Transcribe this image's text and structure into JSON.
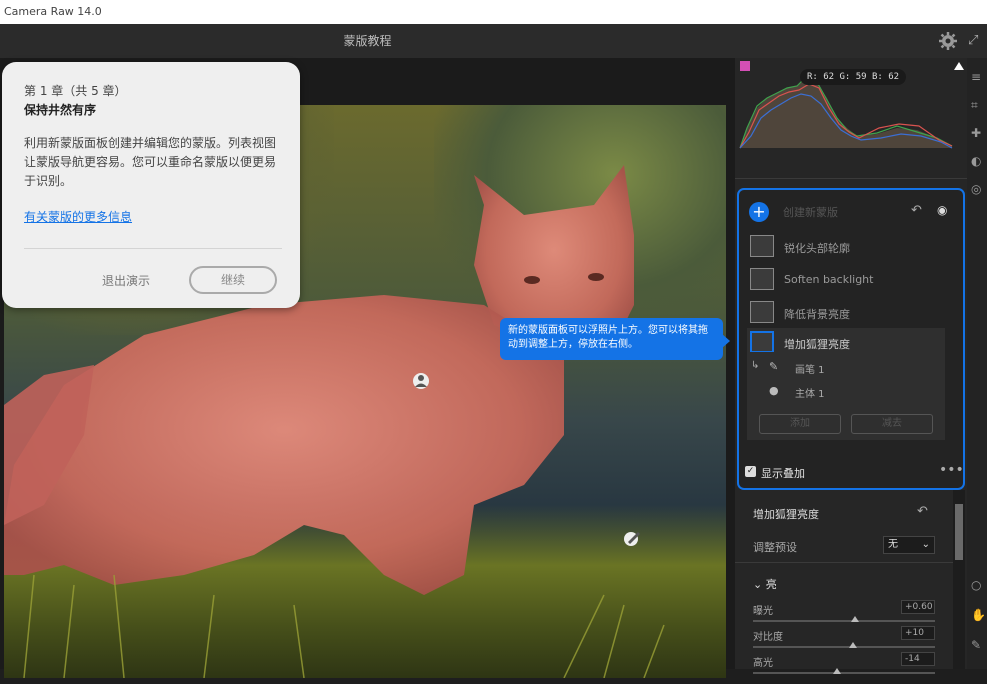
{
  "app": {
    "title": "Camera Raw 14.0"
  },
  "document": {
    "title": "蒙版教程"
  },
  "histogram": {
    "readout": "R: 62   G: 59   B: 62"
  },
  "tour": {
    "chapter": "第 1 章（共 5 章）",
    "heading": "保持井然有序",
    "body": "利用新蒙版面板创建并编辑您的蒙版。列表视图让蒙版导航更容易。您可以重命名蒙版以便更易于识别。",
    "link": "有关蒙版的更多信息",
    "exit_label": "退出演示",
    "continue_label": "继续"
  },
  "callout": {
    "text": "新的蒙版面板可以浮照片上方。您可以将其拖动到调整上方，停放在右侧。"
  },
  "mask_panel": {
    "create_label": "创建新蒙版",
    "masks": [
      {
        "label": "锐化头部轮廓"
      },
      {
        "label": "Soften backlight"
      },
      {
        "label": "降低背景亮度"
      },
      {
        "label": "增加狐狸亮度"
      }
    ],
    "components": [
      {
        "label": "画笔 1"
      },
      {
        "label": "主体 1"
      }
    ],
    "add_label": "添加",
    "subtract_label": "减去",
    "overlay_label": "显示叠加"
  },
  "adjust": {
    "title": "增加狐狸亮度",
    "preset_label": "调整预设",
    "preset_value": "无",
    "section": "亮",
    "sliders": [
      {
        "label": "曝光",
        "value": "+0.60",
        "position": 0.56
      },
      {
        "label": "对比度",
        "value": "+10",
        "position": 0.55
      },
      {
        "label": "高光",
        "value": "-14",
        "position": 0.46
      }
    ]
  },
  "colors": {
    "accent": "#1473e6",
    "overlay": "#d9534f"
  },
  "icons": [
    "gear-icon",
    "expand-icon",
    "plus-icon",
    "undo-icon",
    "eye-icon",
    "more-icon",
    "checkbox-icon",
    "person-pin-icon",
    "brush-pin-icon"
  ]
}
